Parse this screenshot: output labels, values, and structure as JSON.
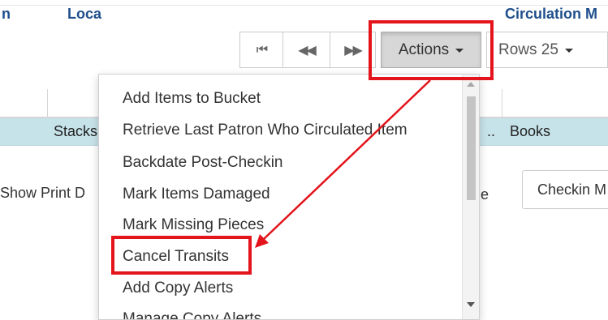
{
  "toolbar": {
    "first_glyph": "⏮",
    "prev_glyph": "◀◀",
    "next_glyph": "▶▶",
    "actions_label": "Actions",
    "rows_label": "Rows 25"
  },
  "table": {
    "headers": [
      "n",
      "Loca",
      "Circulation M"
    ],
    "row": {
      "location": "Stacks",
      "ellipsis": "..",
      "circulation": "Books"
    }
  },
  "below": {
    "show_print": "Show Print D",
    "fragment_e": "e",
    "checkin_label": "Checkin M"
  },
  "menu": {
    "items": [
      "Add Items to Bucket",
      "Retrieve Last Patron Who Circulated Item",
      "Backdate Post-Checkin",
      "Mark Items Damaged",
      "Mark Missing Pieces",
      "Cancel Transits",
      "Add Copy Alerts",
      "Manage Copy Alerts"
    ]
  },
  "annotation": {
    "color": "#e3141b"
  }
}
